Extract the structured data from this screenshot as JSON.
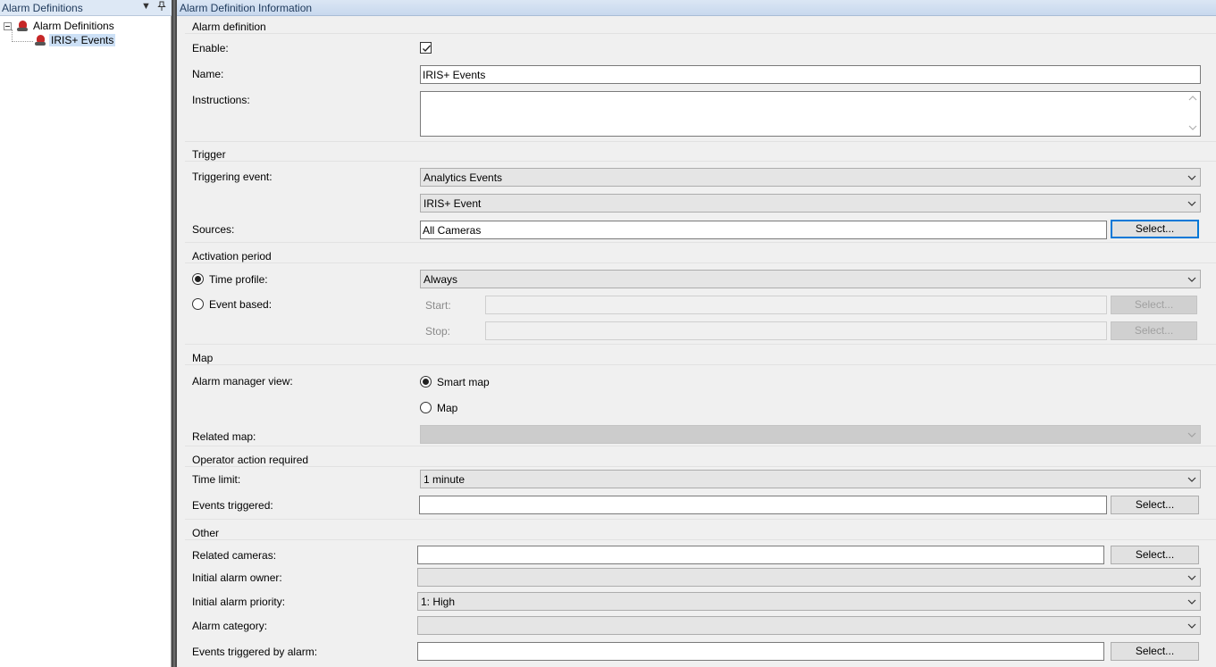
{
  "left_panel": {
    "title": "Alarm Definitions",
    "dropdown_glyph": "▼",
    "pin_glyph": "📌",
    "tree": {
      "root_label": "Alarm Definitions",
      "child_label": "IRIS+ Events"
    }
  },
  "right_panel": {
    "title": "Alarm Definition Information"
  },
  "alarm_definition": {
    "section_title": "Alarm definition",
    "enable_label": "Enable:",
    "enable_checked": true,
    "name_label": "Name:",
    "name_value": "IRIS+ Events",
    "instructions_label": "Instructions:",
    "instructions_value": ""
  },
  "trigger": {
    "section_title": "Trigger",
    "triggering_event_label": "Triggering event:",
    "triggering_event_value": "Analytics Events",
    "event_value": "IRIS+ Event",
    "sources_label": "Sources:",
    "sources_value": "All Cameras",
    "select_label": "Select..."
  },
  "activation_period": {
    "section_title": "Activation period",
    "time_profile_label": "Time profile:",
    "time_profile_value": "Always",
    "event_based_label": "Event based:",
    "start_label": "Start:",
    "stop_label": "Stop:",
    "start_select_label": "Select...",
    "stop_select_label": "Select..."
  },
  "map": {
    "section_title": "Map",
    "alarm_manager_view_label": "Alarm manager view:",
    "smart_map_label": "Smart map",
    "map_label": "Map",
    "related_map_label": "Related map:",
    "related_map_value": ""
  },
  "operator_action": {
    "section_title": "Operator action required",
    "time_limit_label": "Time limit:",
    "time_limit_value": "1 minute",
    "events_triggered_label": "Events triggered:",
    "events_triggered_value": "",
    "select_label": "Select..."
  },
  "other": {
    "section_title": "Other",
    "related_cameras_label": "Related cameras:",
    "related_cameras_value": "",
    "related_cameras_select": "Select...",
    "initial_owner_label": "Initial alarm owner:",
    "initial_owner_value": "",
    "initial_priority_label": "Initial alarm priority:",
    "initial_priority_value": "1: High",
    "alarm_category_label": "Alarm category:",
    "alarm_category_value": "",
    "events_by_alarm_label": "Events triggered by alarm:",
    "events_by_alarm_value": "",
    "events_by_alarm_select": "Select..."
  },
  "colors": {
    "focus_border": "#0078d7",
    "selection_bg": "#cce0f6",
    "header_bg": "#dbe6f4",
    "alarm_icon": "#c62828"
  }
}
